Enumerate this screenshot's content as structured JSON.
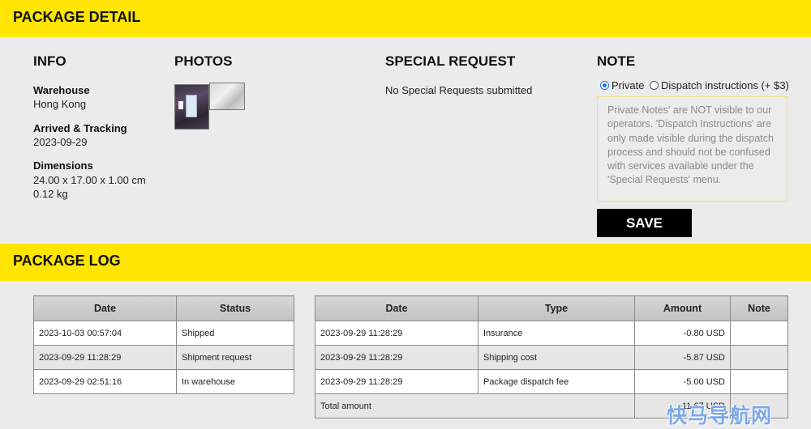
{
  "package_detail": {
    "heading": "PACKAGE DETAIL",
    "info": {
      "title": "INFO",
      "warehouse_label": "Warehouse",
      "warehouse_value": "Hong Kong",
      "arrived_label": "Arrived & Tracking",
      "arrived_value": "2023-09-29",
      "dimensions_label": "Dimensions",
      "dimensions_value": "24.00 x 17.00 x 1.00 cm",
      "weight_value": "0.12 kg"
    },
    "photos": {
      "title": "PHOTOS"
    },
    "special_request": {
      "title": "SPECIAL REQUEST",
      "text": "No Special Requests submitted"
    },
    "note": {
      "title": "NOTE",
      "option_private": "Private",
      "option_dispatch": "Dispatch instructions (+ $3)",
      "selected": "Private",
      "placeholder": "Private Notes' are NOT visible to our operators. 'Dispatch Instructions' are only made visible during the dispatch process and should not be confused with services available under the 'Special Requests' menu.",
      "save_label": "SAVE"
    }
  },
  "package_log": {
    "heading": "PACKAGE LOG",
    "status_table": {
      "headers": [
        "Date",
        "Status"
      ],
      "rows": [
        [
          "2023-10-03 00:57:04",
          "Shipped"
        ],
        [
          "2023-09-29 11:28:29",
          "Shipment request"
        ],
        [
          "2023-09-29 02:51:16",
          "In warehouse"
        ]
      ]
    },
    "charges_table": {
      "headers": [
        "Date",
        "Type",
        "Amount",
        "Note"
      ],
      "rows": [
        [
          "2023-09-29 11:28:29",
          "Insurance",
          "-0.80 USD",
          ""
        ],
        [
          "2023-09-29 11:28:29",
          "Shipping cost",
          "-5.87 USD",
          ""
        ],
        [
          "2023-09-29 11:28:29",
          "Package dispatch fee",
          "-5.00 USD",
          ""
        ]
      ],
      "total_label": "Total amount",
      "total_value": "-11.67 USD"
    }
  },
  "watermark": "快马导航网",
  "colors": {
    "accent": "#ffe500",
    "button": "#000000"
  }
}
